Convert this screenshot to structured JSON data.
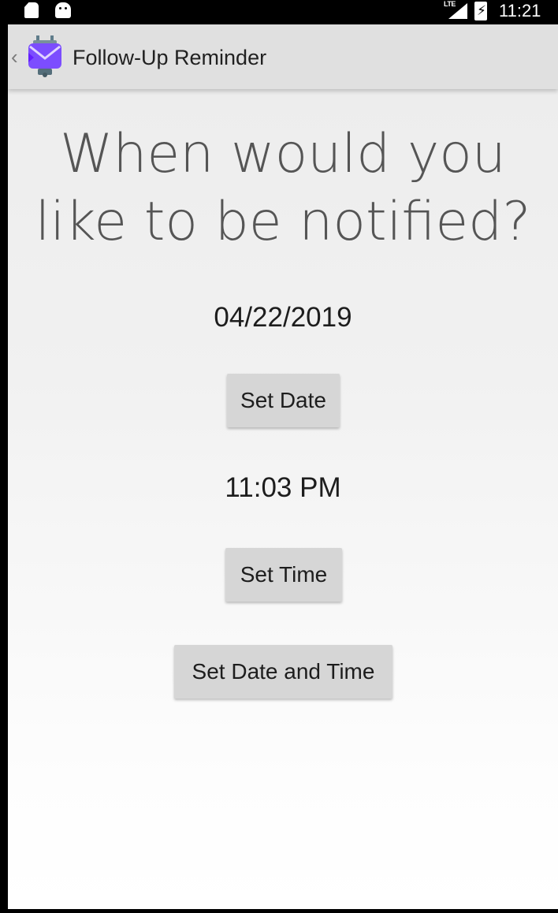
{
  "status_bar": {
    "network_label": "LTE",
    "time": "11:21",
    "icons": [
      "sd-card-icon",
      "android-icon",
      "signal-icon",
      "battery-charging-icon"
    ]
  },
  "toolbar": {
    "title": "Follow-Up Reminder",
    "back_icon": "chevron-left-icon",
    "app_icon": "envelope-robot-icon",
    "background": "#e0e0e0"
  },
  "main": {
    "heading": "When would you like to be notified?",
    "date_value": "04/22/2019",
    "set_date_label": "Set Date",
    "time_value": "11:03 PM",
    "set_time_label": "Set Time",
    "set_date_time_label": "Set Date and Time"
  },
  "colors": {
    "app_icon_purple": "#7c4dff",
    "button_bg": "#d6d6d6"
  }
}
